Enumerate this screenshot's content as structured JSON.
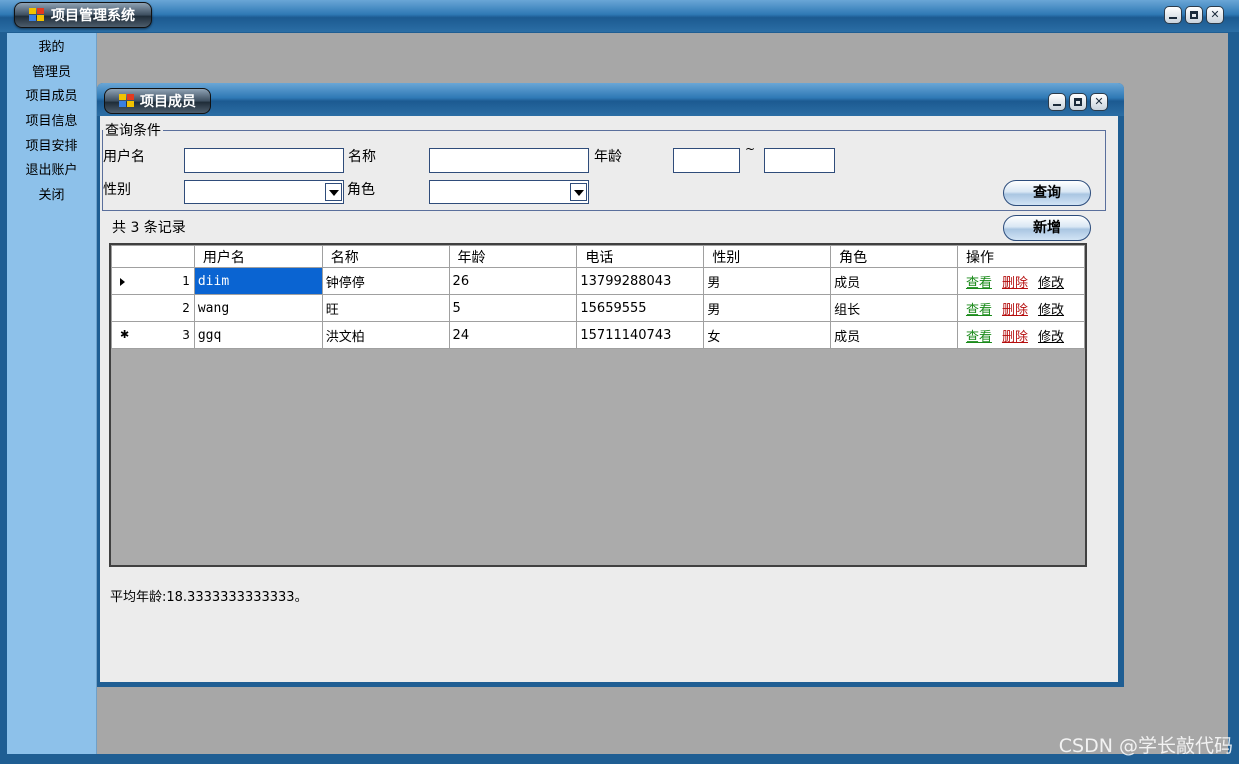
{
  "app": {
    "title": "项目管理系统",
    "watermark": "CSDN @学长敲代码"
  },
  "sidebar": {
    "items": [
      {
        "label": "我的"
      },
      {
        "label": "管理员"
      },
      {
        "label": "项目成员"
      },
      {
        "label": "项目信息"
      },
      {
        "label": "项目安排"
      },
      {
        "label": "退出账户"
      },
      {
        "label": "关闭"
      }
    ]
  },
  "child": {
    "title": "项目成员"
  },
  "query": {
    "legend": "查询条件",
    "username_label": "用户名",
    "name_label": "名称",
    "age_label": "年龄",
    "age_range_sep": "~",
    "gender_label": "性别",
    "role_label": "角色",
    "username_value": "",
    "name_value": "",
    "age_from_value": "",
    "age_to_value": "",
    "gender_value": "",
    "role_value": "",
    "search_button": "查询",
    "add_button": "新增"
  },
  "records": {
    "count_text": "共 3 条记录"
  },
  "table": {
    "columns": [
      "用户名",
      "名称",
      "年龄",
      "电话",
      "性别",
      "角色",
      "操作"
    ],
    "rows": [
      {
        "index": "1",
        "username": "diim",
        "name": "钟停停",
        "age": "26",
        "phone": "13799288043",
        "gender": "男",
        "role": "成员"
      },
      {
        "index": "2",
        "username": "wang",
        "name": "旺",
        "age": "5",
        "phone": "15659555",
        "gender": "男",
        "role": "组长"
      },
      {
        "index": "3",
        "username": "ggq",
        "name": "洪文柏",
        "age": "24",
        "phone": "15711140743",
        "gender": "女",
        "role": "成员"
      }
    ],
    "actions": {
      "view": "查看",
      "delete": "删除",
      "edit": "修改"
    }
  },
  "footer": {
    "avg_age_text": "平均年龄:18.3333333333333。"
  }
}
